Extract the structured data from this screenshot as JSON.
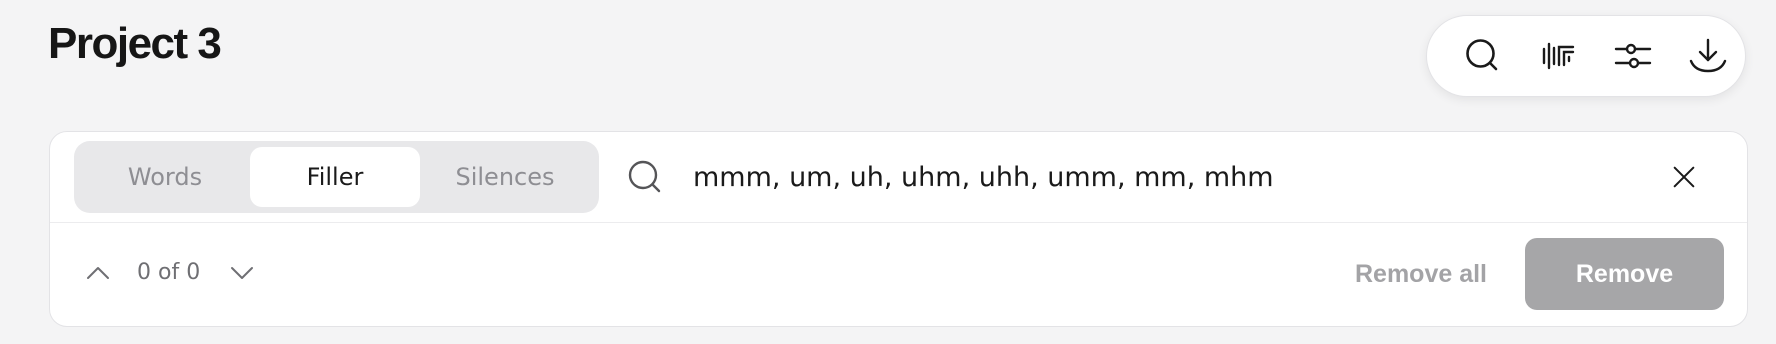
{
  "page": {
    "title": "Project 3"
  },
  "toolbar": {
    "buttons": [
      {
        "icon": "search-icon"
      },
      {
        "icon": "waveform-filter-icon"
      },
      {
        "icon": "sliders-icon"
      },
      {
        "icon": "download-icon"
      }
    ]
  },
  "find_panel": {
    "tabs": [
      {
        "label": "Words",
        "active": false
      },
      {
        "label": "Filler",
        "active": true
      },
      {
        "label": "Silences",
        "active": false
      }
    ],
    "search": {
      "value": "mmm, um, uh, uhm, uhh, umm, mm, mhm",
      "icon": "search-icon",
      "clear_icon": "close-icon"
    },
    "navigation": {
      "counter": "0 of 0",
      "prev_icon": "chevron-up-icon",
      "next_icon": "chevron-down-icon"
    },
    "actions": {
      "remove_all_label": "Remove all",
      "remove_label": "Remove"
    }
  },
  "colors": {
    "background": "#f4f4f5",
    "panel": "#ffffff",
    "segment_bg": "#e8e8ea",
    "disabled_button": "#a6a6a8",
    "muted_text": "#a3a3a6"
  }
}
